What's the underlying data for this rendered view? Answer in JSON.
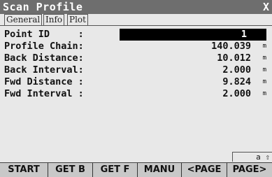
{
  "window": {
    "title": "Scan Profile",
    "close_glyph": "X"
  },
  "tabs": [
    {
      "label": "General",
      "active": true
    },
    {
      "label": "Info",
      "active": false
    },
    {
      "label": "Plot",
      "active": false
    }
  ],
  "fields": [
    {
      "label": "Point ID     :",
      "value": "1",
      "unit": ""
    },
    {
      "label": "Profile Chain:",
      "value": "140.039",
      "unit": "m"
    },
    {
      "label": "Back Distance:",
      "value": "10.012",
      "unit": "m"
    },
    {
      "label": "Back Interval:",
      "value": "2.000",
      "unit": "m"
    },
    {
      "label": "Fwd Distance :",
      "value": "9.824",
      "unit": "m"
    },
    {
      "label": "Fwd Interval :",
      "value": "2.000",
      "unit": "m"
    }
  ],
  "status": {
    "indicator": "a ⇧"
  },
  "softkeys": [
    "START",
    "GET B",
    "GET F",
    "MANU",
    "<PAGE",
    "PAGE>"
  ]
}
